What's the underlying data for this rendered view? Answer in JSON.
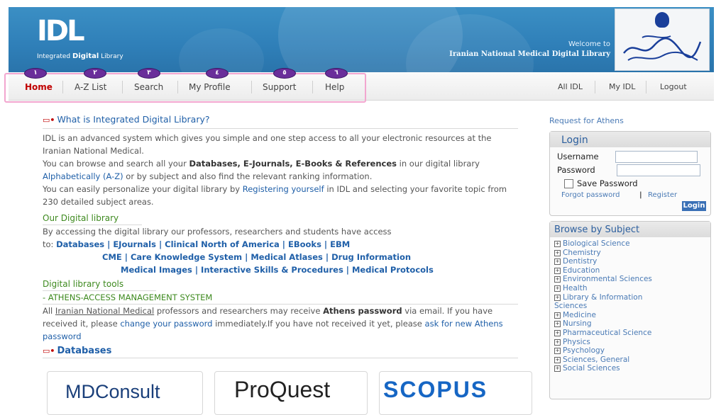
{
  "header": {
    "logo_mark": "IDL",
    "logo_tagline_prefix": "Integrated",
    "logo_tagline_bold": "Digital",
    "logo_tagline_suffix": "Library",
    "welcome_line1": "Welcome to",
    "welcome_line2": "Iranian National Medical Digital Library"
  },
  "nav": {
    "items": [
      {
        "label": "Home",
        "number": "١"
      },
      {
        "label": "A-Z List",
        "number": "٢"
      },
      {
        "label": "Search",
        "number": "٣"
      },
      {
        "label": "My Profile",
        "number": "٤"
      },
      {
        "label": "Support",
        "number": "٥"
      },
      {
        "label": "Help",
        "number": "٦"
      }
    ],
    "right": [
      "All IDL",
      "My IDL",
      "Logout"
    ]
  },
  "intro": {
    "heading": "What is Integrated Digital Library?",
    "p1": "IDL is an advanced system which gives you simple and one step access to all your electronic resources at the Iranian National Medical.",
    "p2_a": "You can browse and search all your ",
    "p2_b": "Databases, E-Journals, E-Books & References",
    "p2_c": " in our digital library ",
    "p2_d": "Alphabetically (A-Z)",
    "p2_e": " or by subject and also find the relevant ranking information.",
    "p3_a": "You can easily personalize your digital library by ",
    "p3_b": "Registering yourself",
    "p3_c": " in IDL and selecting your favorite topic from 230 detailed subject areas."
  },
  "our_library": {
    "heading": "Our Digital library",
    "text1": "By accessing the digital library our professors, researchers and students have access",
    "text2": "to:",
    "row1": "Databases | EJournals | Clinical North of America | EBooks | EBM",
    "row2": "CME | Care Knowledge System | Medical Atlases | Drug Information",
    "row3": "Medical Images | Interactive Skills & Procedures | Medical Protocols"
  },
  "tools": {
    "heading": "Digital library tools",
    "athens_heading": "- ATHENS-ACCESS MANAGEMENT SYSTEM",
    "t_a": "All ",
    "t_b": "Iranian National Medical",
    "t_c": " professors and researchers may receive ",
    "t_d": "Athens password",
    "t_e": " via email. If you have received it, please ",
    "t_f": "change your password",
    "t_g": " immediately.If you have not received it yet, please ",
    "t_h": "ask for new Athens password"
  },
  "databases": {
    "heading": "Databases",
    "logos": [
      "MDConsult",
      "ProQuest",
      "SCOPUS"
    ]
  },
  "login": {
    "request_link": "Request for Athens",
    "title": "Login",
    "username_label": "Username",
    "password_label": "Password",
    "save_password": "Save Password",
    "forgot": "Forgot password",
    "separator": "|",
    "register": "Register",
    "button": "Login"
  },
  "browse": {
    "title": "Browse by Subject",
    "subjects": [
      "Biological Science",
      "Chemistry",
      "Dentistry",
      "Education",
      "Environmental Sciences",
      "Health",
      "Library & Information Sciences",
      "Medicine",
      "Nursing",
      "Pharmaceutical Science",
      "Physics",
      "Psychology",
      "Sciences, General",
      "Social Sciences"
    ]
  },
  "colors": {
    "header_blue": "#2f7fb8",
    "active_red": "#c00000",
    "link_blue": "#1f5fa8",
    "green": "#3e8a1f",
    "bubble_purple": "#6a2e9a",
    "highlight_pink": "#f2a6cf"
  }
}
